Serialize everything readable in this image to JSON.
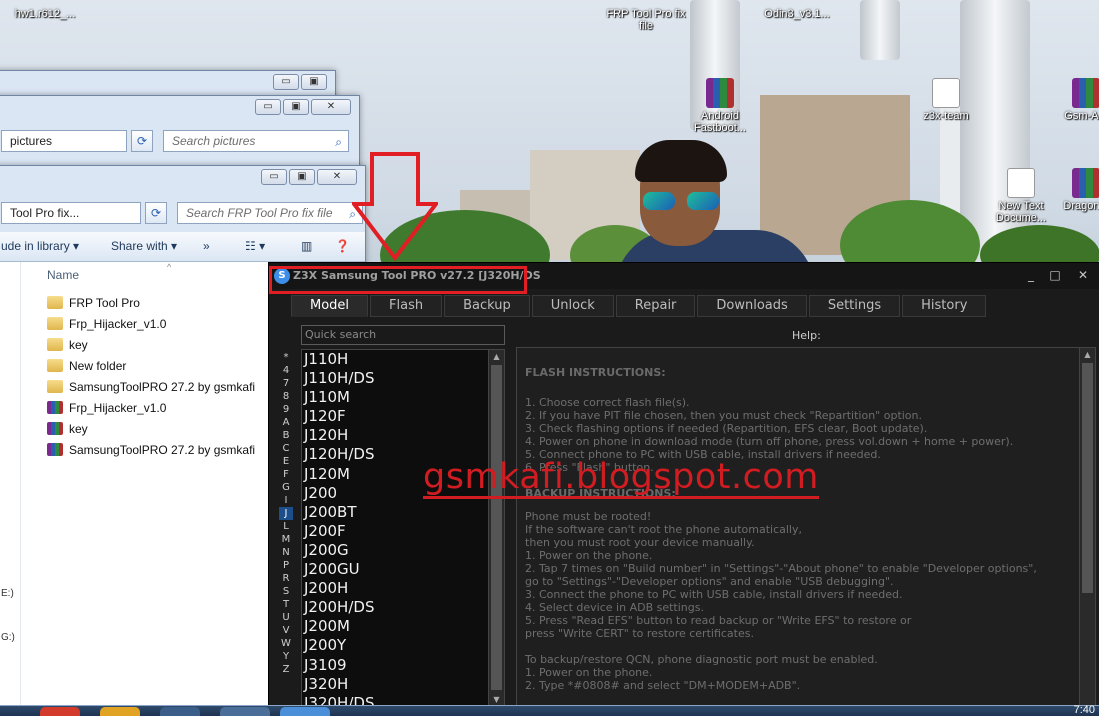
{
  "desktop_icons": [
    {
      "label": "hw1.r612_..."
    },
    {
      "label": "FRP Tool Pro fix file"
    },
    {
      "label": "Odin3_v3.1..."
    },
    {
      "label": "Android Fastboot..."
    },
    {
      "label": "z3x-team"
    },
    {
      "label": "Gsm-A..."
    },
    {
      "label": "New Text Docume..."
    },
    {
      "label": "Dragon..."
    }
  ],
  "explorer_back": {
    "caption_min": "▭",
    "caption_max": "▣",
    "caption_close": "✕",
    "address": "pictures",
    "search_placeholder": "Search pictures"
  },
  "explorer": {
    "address": "Tool Pro fix...",
    "search_placeholder": "Search FRP Tool Pro fix file",
    "toolbar": {
      "include_label": "ude in library",
      "share_label": "Share with",
      "more_label": "»"
    },
    "column_name": "Name",
    "nav_ticks": [
      "E:)",
      "G:)"
    ],
    "files": [
      {
        "name": "FRP Tool Pro",
        "type": "folder"
      },
      {
        "name": "Frp_Hijacker_v1.0",
        "type": "folder"
      },
      {
        "name": "key",
        "type": "folder"
      },
      {
        "name": "New folder",
        "type": "folder"
      },
      {
        "name": "SamsungToolPRO 27.2 by gsmkafi",
        "type": "folder"
      },
      {
        "name": "Frp_Hijacker_v1.0",
        "type": "rar"
      },
      {
        "name": "key",
        "type": "rar"
      },
      {
        "name": "SamsungToolPRO 27.2 by gsmkafi",
        "type": "rar"
      }
    ]
  },
  "z3x": {
    "title": "Z3X Samsung Tool PRO v27.2 [J320H/DS",
    "app_icon": "S",
    "btn_min": "_",
    "btn_max": "□",
    "btn_close": "✕",
    "tabs": [
      "Model",
      "Flash",
      "Backup",
      "Unlock",
      "Repair",
      "Downloads",
      "Settings",
      "History"
    ],
    "active_tab": "Model",
    "quick_search_placeholder": "Quick search",
    "help_label": "Help:",
    "alphabet": [
      "*",
      "4",
      "7",
      "8",
      "9",
      "A",
      "B",
      "C",
      "E",
      "F",
      "G",
      "I",
      "J",
      "L",
      "M",
      "N",
      "P",
      "R",
      "S",
      "T",
      "U",
      "V",
      "W",
      "Y",
      "Z"
    ],
    "selected_letter": "J",
    "models": [
      "J110H",
      "J110H/DS",
      "J110M",
      "J120F",
      "J120H",
      "J120H/DS",
      "J120M",
      "J200",
      "J200BT",
      "J200F",
      "J200G",
      "J200GU",
      "J200H",
      "J200H/DS",
      "J200M",
      "J200Y",
      "J3109",
      "J320H",
      "J320H/DS"
    ],
    "help": {
      "flash_heading": "FLASH INSTRUCTIONS:",
      "flash_lines": [
        "1. Choose correct flash file(s).",
        "2. If you have PIT file chosen, then you must check \"Repartition\" option.",
        "3. Check flashing options if needed (Repartition, EFS clear, Boot update).",
        "4. Power on phone in download mode (turn off phone, press vol.down + home + power).",
        "5. Connect phone to PC with USB cable, install drivers if needed.",
        "6. Press \"Flash\" button."
      ],
      "backup_heading": "BACKUP INSTRUCTIONS:",
      "backup_lines": [
        "  Phone must be rooted!",
        "If the software can't root the phone automatically,",
        "then you must root your device manually.",
        "1. Power on the phone.",
        "2. Tap 7 times on \"Build number\" in \"Settings\"-\"About phone\" to enable \"Developer options\",",
        "   go to \"Settings\"-\"Developer options\" and enable \"USB debugging\".",
        "3. Connect the phone to PC with USB cable, install drivers if needed.",
        "4. Select device in ADB settings.",
        "5. Press \"Read EFS\" button to read backup or \"Write EFS\" to restore or",
        "   press \"Write CERT\" to restore certificates."
      ],
      "qcn_lines": [
        " To backup/restore QCN, phone diagnostic port must be enabled.",
        "1. Power on the phone.",
        "2. Type *#0808# and select \"DM+MODEM+ADB\"."
      ]
    }
  },
  "watermark": "gsmkafi.blogspot.com",
  "taskbar": {
    "clock": "7:40"
  },
  "colors": {
    "highlight_red": "#e01e24",
    "watermark_red": "#d11c21",
    "z3x_bg": "#1b1b1b",
    "selected_letter_bg": "#1d4e8c"
  }
}
